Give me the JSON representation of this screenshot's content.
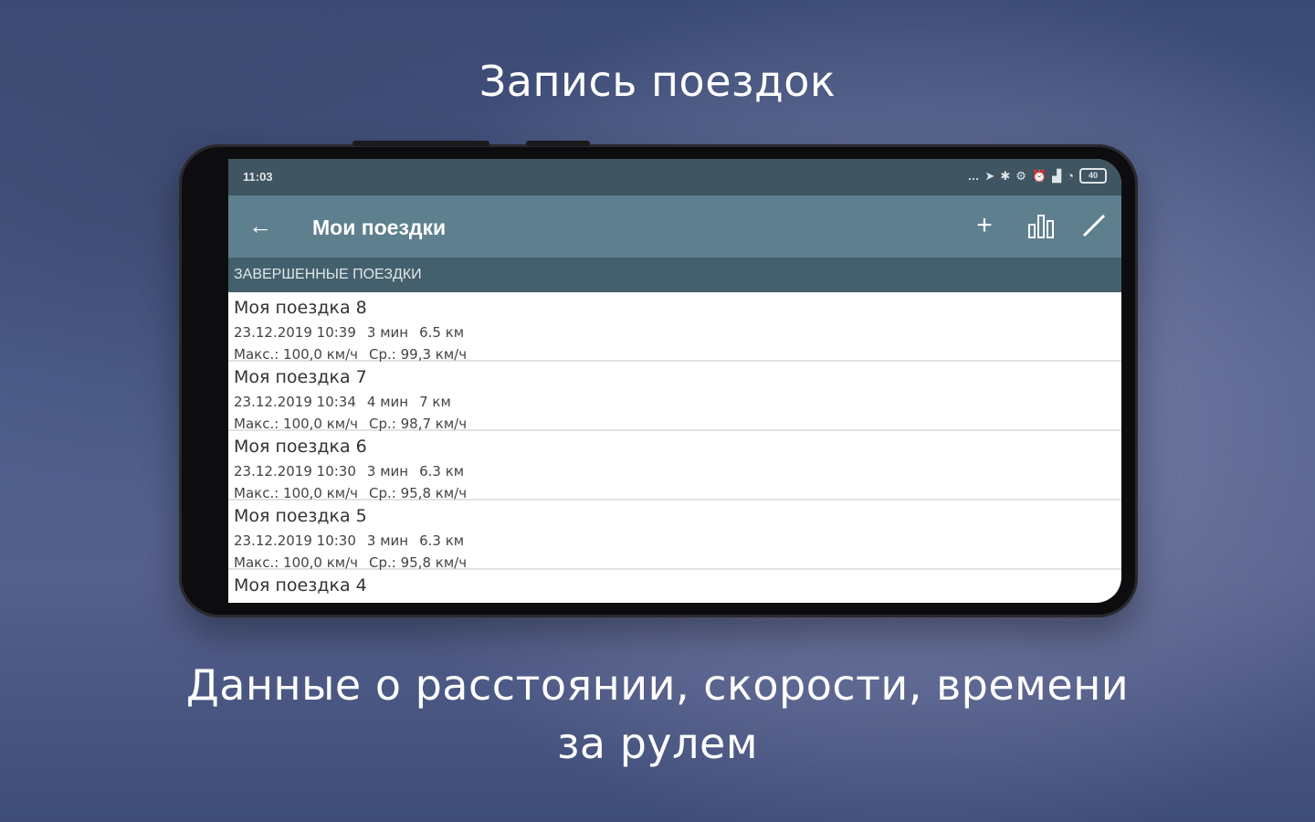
{
  "promo": {
    "title": "Запись поездок",
    "subtitle": "Данные о расстоянии, скорости, времени за рулем"
  },
  "status_bar": {
    "time": "11:03",
    "battery": "40"
  },
  "app_bar": {
    "title": "Мои поездки",
    "icons": [
      "back-arrow-icon",
      "add-icon",
      "bar-chart-icon",
      "edit-pencil-icon"
    ]
  },
  "section": {
    "header": "Завершенные поездки"
  },
  "trips": [
    {
      "name": "Моя поездка 8",
      "datetime": "23.12.2019 10:39",
      "duration": "3 мин",
      "distance": "6.5 км",
      "max": "Макс.: 100,0 км/ч",
      "avg": "Ср.: 99,3 км/ч"
    },
    {
      "name": "Моя поездка 7",
      "datetime": "23.12.2019 10:34",
      "duration": "4 мин",
      "distance": "7 км",
      "max": "Макс.: 100,0 км/ч",
      "avg": "Ср.: 98,7 км/ч"
    },
    {
      "name": "Моя поездка 6",
      "datetime": "23.12.2019 10:30",
      "duration": "3 мин",
      "distance": "6.3 км",
      "max": "Макс.: 100,0 км/ч",
      "avg": "Ср.: 95,8 км/ч"
    },
    {
      "name": "Моя поездка 5",
      "datetime": "23.12.2019 10:30",
      "duration": "3 мин",
      "distance": "6.3 км",
      "max": "Макс.: 100,0 км/ч",
      "avg": "Ср.: 95,8 км/ч"
    },
    {
      "name": "Моя поездка 4"
    }
  ],
  "colors": {
    "status_bar": "#3f5561",
    "app_bar": "#5e7f8e",
    "section_header": "#45606d",
    "background": "#4f5f8d"
  }
}
